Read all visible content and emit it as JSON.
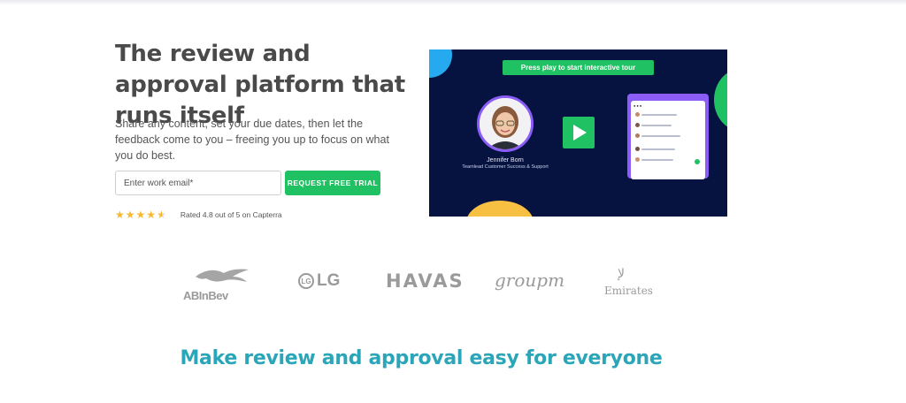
{
  "hero": {
    "headline": "The review and approval platform that runs itself",
    "subtext": "Share any content, set your due dates, then let the feedback come to you – freeing you up to focus on what you do best.",
    "email_placeholder": "Enter work email*",
    "email_value": "",
    "cta_label": "REQUEST FREE TRIAL",
    "rating": {
      "stars": 4.5,
      "max_stars": 5,
      "text": "Rated 4.8 out of 5 on Capterra"
    }
  },
  "video": {
    "banner": "Press play to start interactive tour",
    "person_name": "Jennifer Born",
    "person_role": "Teamlead Customer Success & Support",
    "play_icon": "play-icon"
  },
  "logos": [
    {
      "name": "AB InBev",
      "text": "ABInBev"
    },
    {
      "name": "LG",
      "text": "LG",
      "mark": "LG"
    },
    {
      "name": "Havas",
      "text": "HAVAS"
    },
    {
      "name": "GroupM",
      "text": "groupm"
    },
    {
      "name": "Emirates",
      "text": "Emirates"
    }
  ],
  "section": {
    "tagline": "Make review and approval easy for everyone"
  },
  "colors": {
    "accent_green": "#1fc162",
    "video_bg": "#061340",
    "tagline": "#2aa6b8",
    "star": "#f5b82e",
    "purple": "#8b5cf6"
  }
}
